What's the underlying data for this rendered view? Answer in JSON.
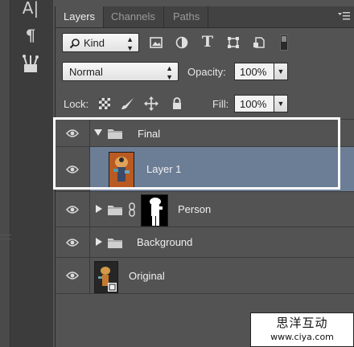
{
  "tools": {
    "type_tool_glyph": "A|",
    "paragraph_glyph": "¶",
    "tool_icons": [
      "type-tool-icon",
      "paragraph-icon",
      "brush-tools-icon"
    ]
  },
  "tabs": [
    {
      "label": "Layers",
      "active": true
    },
    {
      "label": "Channels",
      "active": false
    },
    {
      "label": "Paths",
      "active": false
    }
  ],
  "filter": {
    "kind_label": "Kind",
    "icons": [
      "image-filter-icon",
      "adjustment-filter-icon",
      "type-filter-icon",
      "shape-filter-icon",
      "smart-object-filter-icon"
    ],
    "type_glyph": "T"
  },
  "blend": {
    "mode": "Normal",
    "opacity_label": "Opacity:",
    "opacity_value": "100%"
  },
  "lock": {
    "label": "Lock:",
    "fill_label": "Fill:",
    "fill_value": "100%",
    "icons": [
      "lock-transparent-icon",
      "lock-image-icon",
      "lock-position-icon",
      "lock-all-icon"
    ]
  },
  "layers": [
    {
      "name": "Final",
      "type": "group",
      "expanded": true,
      "selected": false
    },
    {
      "name": "Layer 1",
      "type": "pixel",
      "selected": true
    },
    {
      "name": "Person",
      "type": "group",
      "expanded": false,
      "linked_mask": true
    },
    {
      "name": "Background",
      "type": "group",
      "expanded": false
    },
    {
      "name": "Original",
      "type": "smart-object"
    }
  ],
  "colors": {
    "panel_bg": "#535353",
    "selected_row": "#6c7d96",
    "highlight_border": "#ffffff"
  },
  "watermark": {
    "chinese": "思洋互动",
    "url": "www.ciya.com"
  }
}
